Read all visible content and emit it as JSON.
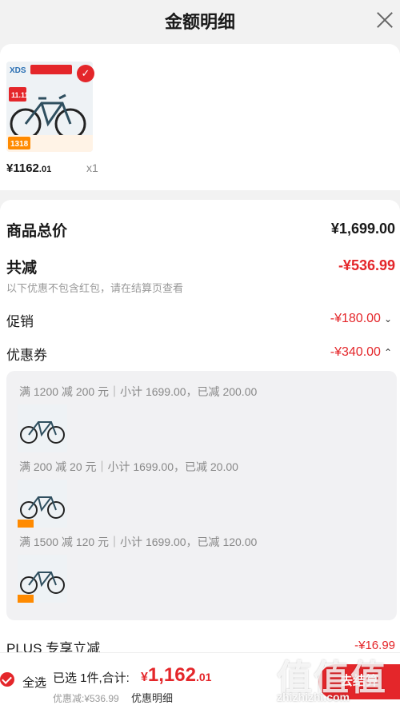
{
  "header": {
    "title": "金额明细"
  },
  "product": {
    "price_int": "¥1162",
    "price_dec": ".01",
    "quantity": "x1",
    "thumb": {
      "brand": "XDS",
      "promo": "11.11",
      "price_tag": "1318"
    }
  },
  "detail": {
    "goods_total_label": "商品总价",
    "goods_total_value": "¥1,699.00",
    "total_reduce_label": "共减",
    "total_reduce_value": "-¥536.99",
    "note": "以下优惠不包含红包，请在结算页查看",
    "promo_label": "促销",
    "promo_value": "-¥180.00",
    "coupon_label": "优惠券",
    "coupon_value": "-¥340.00",
    "coupons": [
      {
        "text": "满 1200 减 200 元｜小计 1699.00，已减 200.00"
      },
      {
        "text": "满 200 减 20 元｜小计 1699.00，已减 20.00"
      },
      {
        "text": "满 1500 减 120 元｜小计 1699.00，已减 120.00"
      }
    ],
    "plus_label": "PLUS 专享立减",
    "plus_value": "-¥16.99"
  },
  "bottom": {
    "select_all": "全选",
    "summary": "已选 1件,合计:",
    "total_cur": "¥",
    "total_int": "1,162",
    "total_dec": ".01",
    "discount_line": "优惠减:¥536.99",
    "detail_toggle": "优惠明细",
    "checkout": "去结算"
  },
  "watermark": {
    "glyphs": "值值值",
    "site": "zhizhizhi.com"
  },
  "colors": {
    "accent": "#e4262a"
  }
}
